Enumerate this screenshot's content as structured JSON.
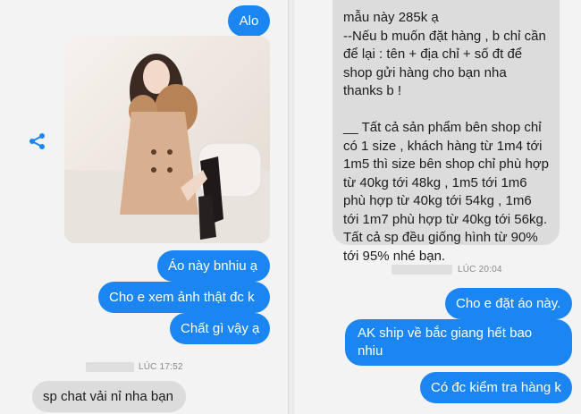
{
  "left_chat": {
    "messages": [
      {
        "side": "out",
        "text": "Alo"
      },
      {
        "side": "out",
        "text": "Áo này bnhiu ạ"
      },
      {
        "side": "out",
        "text": "Cho e xem ảnh thật đc k"
      },
      {
        "side": "out",
        "text": "Chất gì vậy ạ"
      },
      {
        "side": "in",
        "text": "sp chat vải nỉ nha bạn"
      }
    ],
    "timestamp": "LÚC 17:52"
  },
  "right_chat": {
    "messages": [
      {
        "side": "in",
        "text": "mẫu này 285k ạ\n--Nếu b muốn đặt hàng , b chỉ cần để lại : tên + địa chỉ + số đt để shop gửi hàng cho bạn nha thanks b !\n\n__ Tất cả sản phẩm bên shop chỉ có 1 size , khách hàng từ 1m4 tới 1m5 thì size bên shop chỉ phù hợp từ 40kg tới 48kg , 1m5 tới 1m6 phù hợp từ 40kg tới 54kg , 1m6 tới 1m7 phù hợp từ 40kg tới 56kg. Tất cả sp đều giống hình từ 90% tới 95% nhé bạn."
      },
      {
        "side": "out",
        "text": "Cho e đặt áo này."
      },
      {
        "side": "out",
        "text": "AK ship về bắc giang hết bao nhiu"
      },
      {
        "side": "out",
        "text": "Có đc kiểm tra hàng k"
      }
    ],
    "timestamp": "LÚC 20:04"
  },
  "colors": {
    "outgoing_bubble": "#1b86f2",
    "incoming_bubble": "#dcdcdc",
    "share_icon": "#1b86f2"
  },
  "icons": [
    "share-icon"
  ]
}
